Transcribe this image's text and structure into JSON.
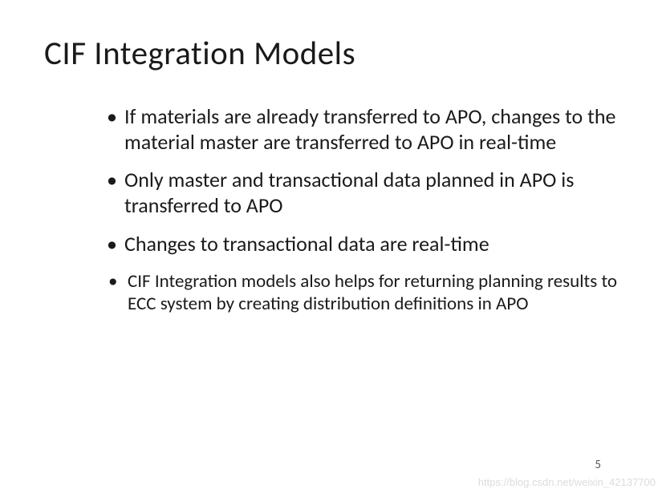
{
  "slide": {
    "title": "CIF Integration Models",
    "bullets": [
      "If materials are already transferred to APO, changes to the material master are transferred to APO in real-time",
      "Only master and transactional data planned in APO is transferred to APO",
      "Changes to transactional data are real-time",
      "CIF  Integration models also helps for returning planning results to ECC system by creating distribution definitions in APO"
    ],
    "page_number": "5"
  },
  "watermark": "https://blog.csdn.net/weixin_42137700"
}
